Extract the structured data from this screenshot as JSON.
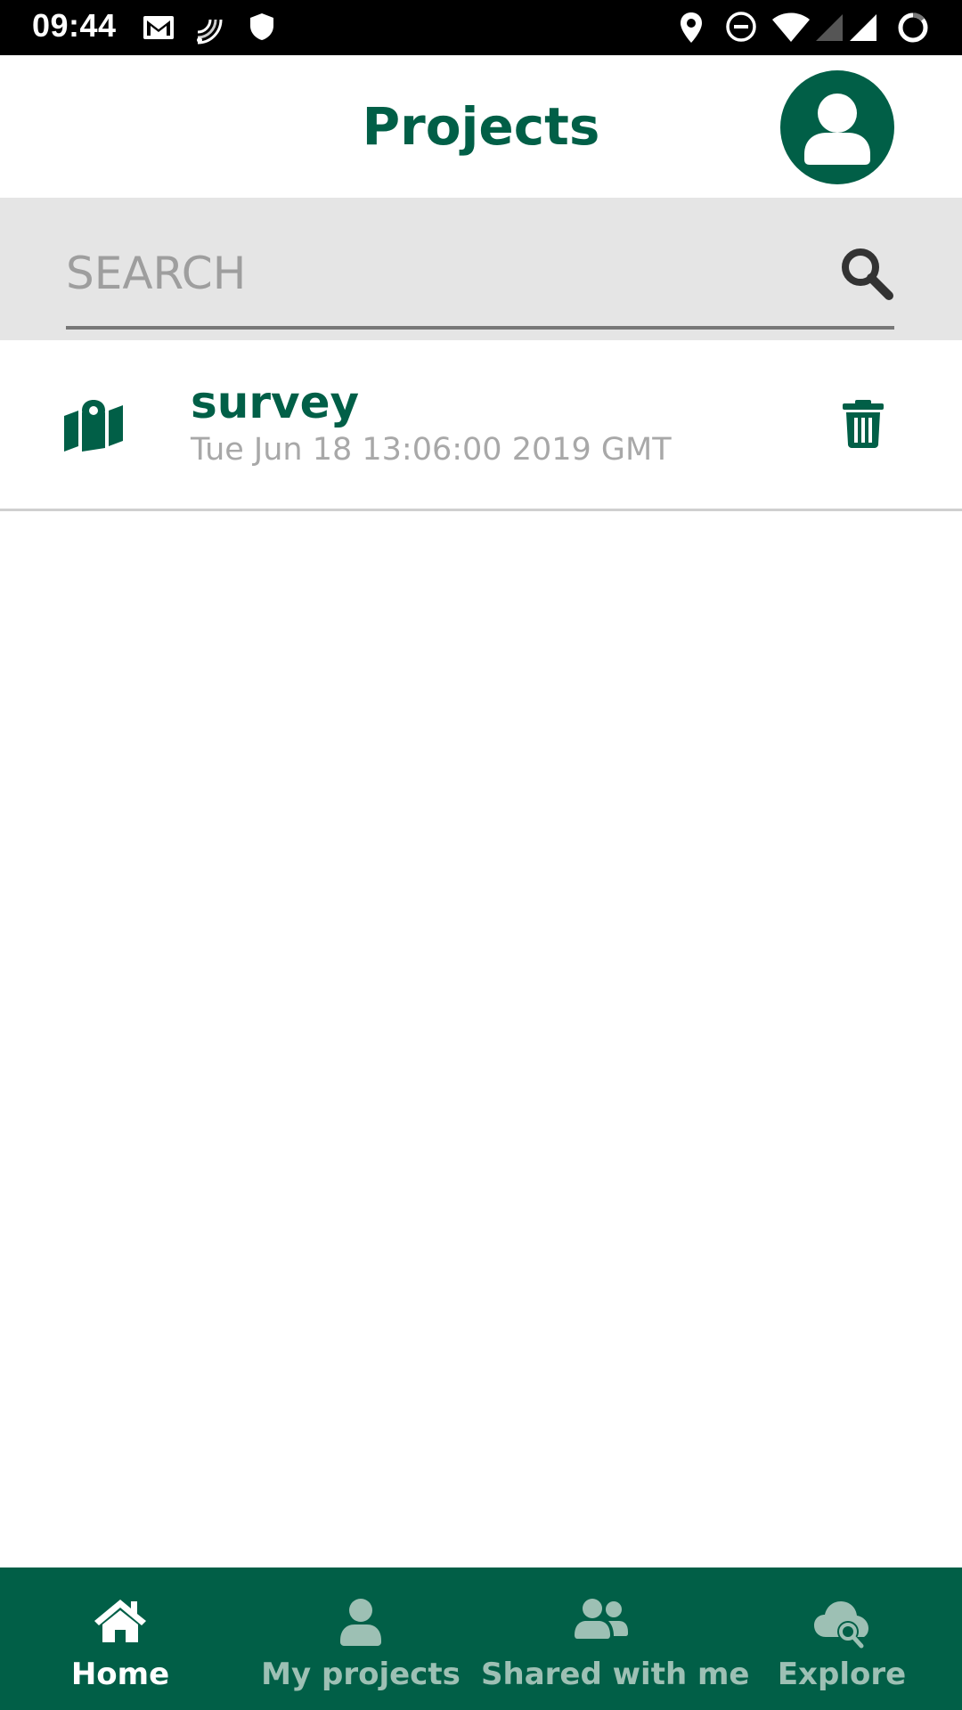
{
  "status_bar": {
    "time": "09:44",
    "left_icons": [
      "gmail-icon",
      "cast-icon",
      "shield-icon"
    ],
    "right_icons": [
      "location-icon",
      "do-not-disturb-icon",
      "wifi-icon",
      "signal-icon",
      "signal-full-icon",
      "battery-ring-icon"
    ]
  },
  "header": {
    "title": "Projects",
    "avatar_icon": "user-icon"
  },
  "search": {
    "placeholder": "SEARCH",
    "value": "",
    "icon": "search-icon"
  },
  "projects": [
    {
      "name": "survey",
      "date": "Tue Jun 18 13:06:00 2019 GMT",
      "icon": "map-marker-icon",
      "action_icon": "trash-icon"
    }
  ],
  "bottom_nav": {
    "items": [
      {
        "label": "Home",
        "icon": "home-icon",
        "active": true
      },
      {
        "label": "My projects",
        "icon": "user-icon",
        "active": false
      },
      {
        "label": "Shared with me",
        "icon": "users-icon",
        "active": false
      },
      {
        "label": "Explore",
        "icon": "cloud-search-icon",
        "active": false
      }
    ]
  },
  "colors": {
    "brand": "#015f47",
    "status_bar": "#000000",
    "search_bg": "#e5e5e5",
    "nav_inactive": "#9dc0b4",
    "secondary_text": "#a8a8a8"
  }
}
